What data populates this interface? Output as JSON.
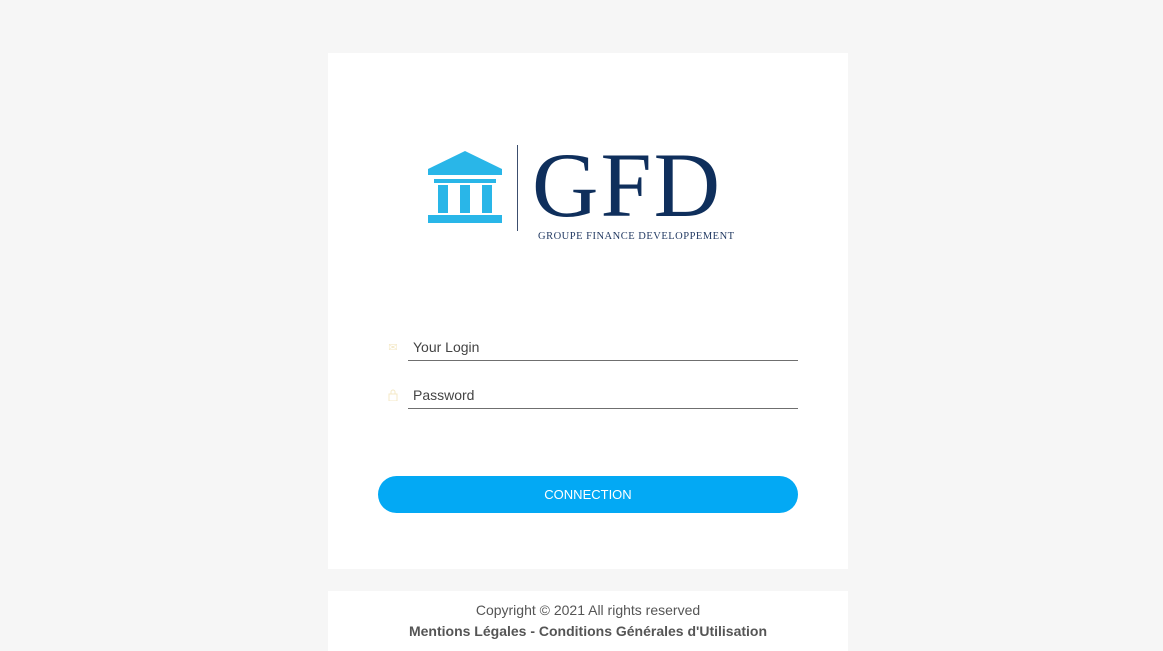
{
  "brand": {
    "letters": "GFD",
    "tagline": "GROUPE FINANCE DEVELOPPEMENT",
    "icon_color": "#29b6e8",
    "text_color": "#0f2f5c"
  },
  "form": {
    "login": {
      "placeholder": "Your Login",
      "value": "",
      "icon": "envelope-icon"
    },
    "password": {
      "placeholder": "Password",
      "value": "",
      "icon": "lock-icon"
    },
    "submit_label": "CONNECTION",
    "accent_color": "#03a9f4"
  },
  "footer": {
    "copyright": "Copyright © 2021 All rights reserved",
    "legal_link": "Mentions Légales",
    "separator": " - ",
    "terms_link": "Conditions Générales d'Utilisation"
  }
}
